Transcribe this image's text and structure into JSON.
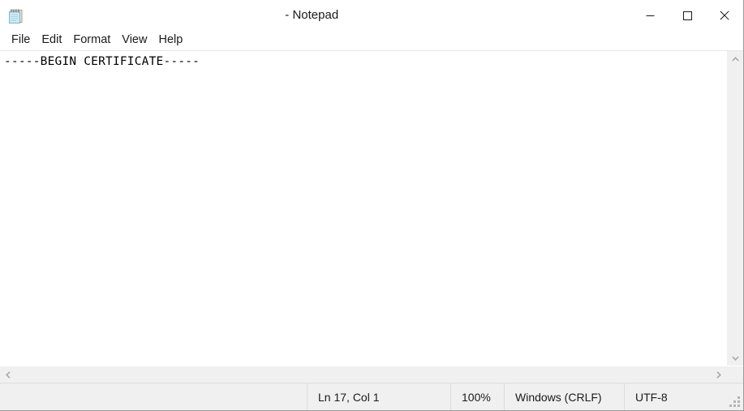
{
  "window": {
    "title": "   - Notepad",
    "app_icon": "notepad-icon",
    "controls": {
      "minimize": "minimize-icon",
      "maximize": "maximize-icon",
      "close": "close-icon"
    }
  },
  "menubar": {
    "items": [
      {
        "label": "File"
      },
      {
        "label": "Edit"
      },
      {
        "label": "Format"
      },
      {
        "label": "View"
      },
      {
        "label": "Help"
      }
    ]
  },
  "editor": {
    "content": "-----BEGIN CERTIFICATE-----",
    "caret_visible": true
  },
  "scrollbars": {
    "vertical": {
      "up": "chevron-up-icon",
      "down": "chevron-down-icon"
    },
    "horizontal": {
      "left": "chevron-left-icon",
      "right": "chevron-right-icon"
    }
  },
  "statusbar": {
    "position": "Ln 17, Col 1",
    "zoom": "100%",
    "line_ending": "Windows (CRLF)",
    "encoding": "UTF-8"
  },
  "colors": {
    "window_bg": "#ffffff",
    "chrome_bg": "#f0f0f0",
    "separator": "#dcdcdc",
    "text": "#1a1a1a",
    "close_hover": "#e81123"
  }
}
